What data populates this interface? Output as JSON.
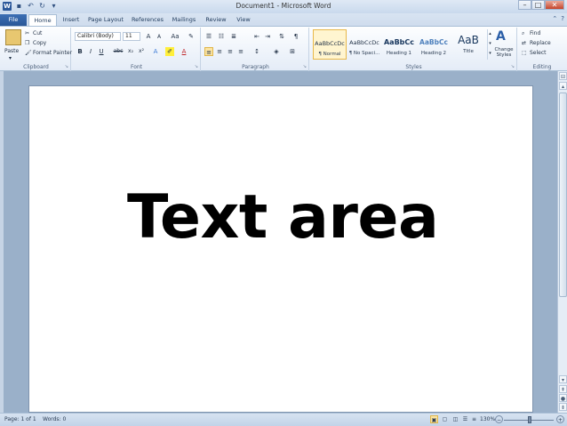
{
  "window": {
    "title": "Document1 - Microsoft Word",
    "app_icon": "W",
    "controls": [
      "–",
      "□",
      "✕"
    ]
  },
  "tabs": {
    "file": "File",
    "items": [
      "Home",
      "Insert",
      "Page Layout",
      "References",
      "Mailings",
      "Review",
      "View"
    ]
  },
  "clipboard": {
    "paste": "Paste",
    "cut": "Cut",
    "copy": "Copy",
    "format_painter": "Format Painter",
    "label": "Clipboard"
  },
  "font": {
    "name": "Calibri (Body)",
    "size": "11",
    "bold": "B",
    "italic": "I",
    "underline": "U",
    "strike": "abc",
    "subscript": "x₂",
    "superscript": "x²",
    "grow": "A",
    "shrink": "A",
    "change_case": "Aa",
    "label": "Font"
  },
  "paragraph": {
    "label": "Paragraph",
    "show_marks": "¶"
  },
  "styles": {
    "label": "Styles",
    "items": [
      {
        "sample": "AaBbCcDc",
        "name": "¶ Normal"
      },
      {
        "sample": "AaBbCcDc",
        "name": "¶ No Spaci..."
      },
      {
        "sample": "AaBbCc",
        "name": "Heading 1"
      },
      {
        "sample": "AaBbCc",
        "name": "Heading 2"
      },
      {
        "sample": "AaB",
        "name": "Title"
      }
    ],
    "change_styles": "Change Styles"
  },
  "editing": {
    "label": "Editing",
    "find": "Find",
    "replace": "Replace",
    "select": "Select"
  },
  "document": {
    "text": "Text area"
  },
  "status": {
    "page": "Page: 1 of 1",
    "words": "Words: 0",
    "zoom": "130%"
  },
  "accent_colors": {
    "file_tab": "#2a5797",
    "doc_background": "#9ab0c9",
    "active_style": "#fff5d0"
  }
}
